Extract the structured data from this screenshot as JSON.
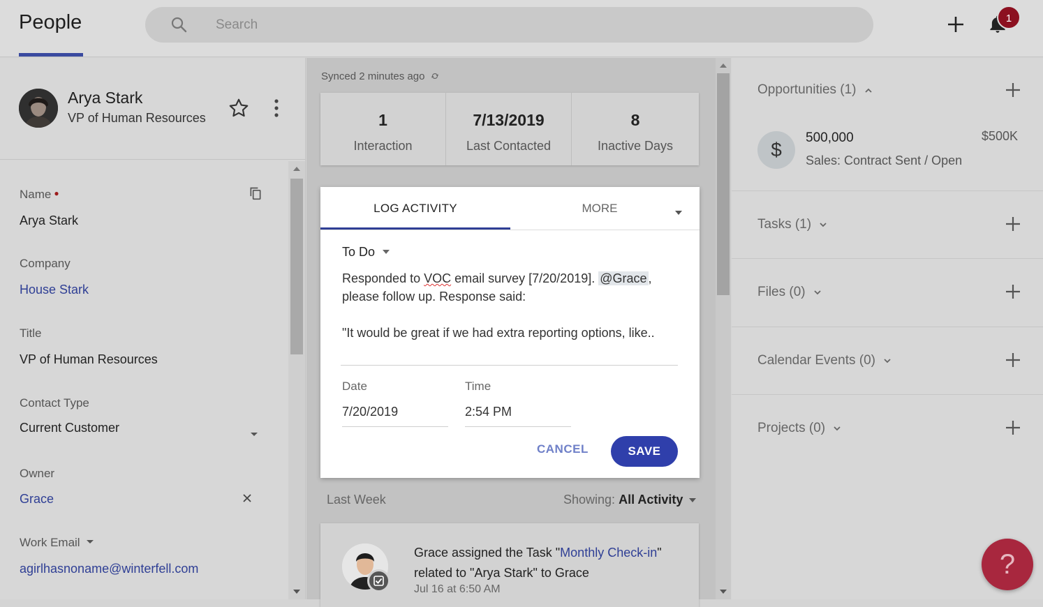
{
  "app": {
    "title": "People"
  },
  "search": {
    "placeholder": "Search"
  },
  "notifications": {
    "count": "1"
  },
  "contact": {
    "name": "Arya Stark",
    "role": "VP of Human Resources",
    "fields": {
      "name_label": "Name",
      "name_value": "Arya Stark",
      "company_label": "Company",
      "company_value": "House Stark",
      "title_label": "Title",
      "title_value": "VP of Human Resources",
      "contact_type_label": "Contact Type",
      "contact_type_value": "Current Customer",
      "owner_label": "Owner",
      "owner_value": "Grace",
      "work_email_label": "Work Email",
      "work_email_value": "agirlhasnoname@winterfell.com"
    }
  },
  "sync": {
    "text": "Synced 2 minutes ago"
  },
  "stats": [
    {
      "value": "1",
      "label": "Interaction"
    },
    {
      "value": "7/13/2019",
      "label": "Last Contacted"
    },
    {
      "value": "8",
      "label": "Inactive Days"
    }
  ],
  "log_activity": {
    "tab_log": "LOG ACTIVITY",
    "tab_more": "MORE",
    "activity_type": "To Do",
    "message_pre": "Responded to ",
    "message_voc": "VOC",
    "message_mid": " email survey [7/20/2019]. ",
    "message_mention": "@Grace",
    "message_post": ", please follow up. Response said:",
    "message_quote": "\"It would be great if we had extra reporting options, like..",
    "date_label": "Date",
    "date_value": "7/20/2019",
    "time_label": "Time",
    "time_value": "2:54 PM",
    "cancel": "CANCEL",
    "save": "SAVE"
  },
  "feed": {
    "period": "Last Week",
    "showing_label": "Showing:",
    "showing_value": "All Activity",
    "item": {
      "pre": "Grace assigned the Task ",
      "quote_open": "\"",
      "task_name": "Monthly Check-in",
      "post": "\" related to \"Arya Stark\" to Grace",
      "date": "Jul 16 at 6:50 AM"
    }
  },
  "sidebar": {
    "opportunities": {
      "title": "Opportunities (1)",
      "item": {
        "name": "500,000",
        "stage": "Sales: Contract Sent / Open",
        "amount": "$500K",
        "icon": "$"
      }
    },
    "tasks": {
      "title": "Tasks (1)"
    },
    "files": {
      "title": "Files (0)"
    },
    "calendar": {
      "title": "Calendar Events (0)"
    },
    "projects": {
      "title": "Projects (0)"
    }
  },
  "help": {
    "label": "?"
  },
  "colors": {
    "accent": "#2f3fab",
    "link": "#2f3f95",
    "badge": "#8c1020",
    "help": "#a8273e"
  }
}
